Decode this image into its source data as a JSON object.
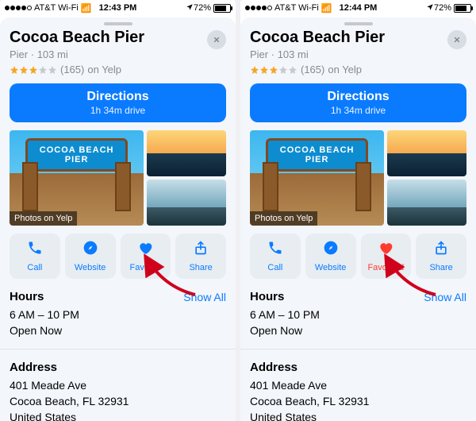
{
  "panels": [
    {
      "status": {
        "carrier": "AT&T Wi-Fi",
        "time": "12:43 PM",
        "battery_pct": "72%",
        "signal_bars": 4,
        "loc_arrow": true
      },
      "place": {
        "name": "Cocoa Beach Pier",
        "category": "Pier",
        "distance": "103 mi",
        "rating_stars": 3,
        "review_count": "(165)",
        "review_src": "on Yelp"
      },
      "directions": {
        "label": "Directions",
        "eta": "1h 34m drive"
      },
      "photos_badge": "Photos on Yelp",
      "actions": {
        "call": "Call",
        "website": "Website",
        "favorite": "Favorite",
        "share": "Share",
        "favorited": false
      },
      "hours": {
        "title": "Hours",
        "show_all": "Show All",
        "range": "6 AM – 10 PM",
        "status": "Open Now"
      },
      "address": {
        "title": "Address",
        "line1": "401 Meade Ave",
        "line2": "Cocoa Beach, FL  32931",
        "line3": "United States"
      }
    },
    {
      "status": {
        "carrier": "AT&T Wi-Fi",
        "time": "12:44 PM",
        "battery_pct": "72%",
        "signal_bars": 4,
        "loc_arrow": true
      },
      "place": {
        "name": "Cocoa Beach Pier",
        "category": "Pier",
        "distance": "103 mi",
        "rating_stars": 3,
        "review_count": "(165)",
        "review_src": "on Yelp"
      },
      "directions": {
        "label": "Directions",
        "eta": "1h 34m drive"
      },
      "photos_badge": "Photos on Yelp",
      "actions": {
        "call": "Call",
        "website": "Website",
        "favorite": "Favorited",
        "share": "Share",
        "favorited": true
      },
      "hours": {
        "title": "Hours",
        "show_all": "Show All",
        "range": "6 AM – 10 PM",
        "status": "Open Now"
      },
      "address": {
        "title": "Address",
        "line1": "401 Meade Ave",
        "line2": "Cocoa Beach, FL  32931",
        "line3": "United States"
      }
    }
  ],
  "arch_text": "COCOA BEACH PIER"
}
